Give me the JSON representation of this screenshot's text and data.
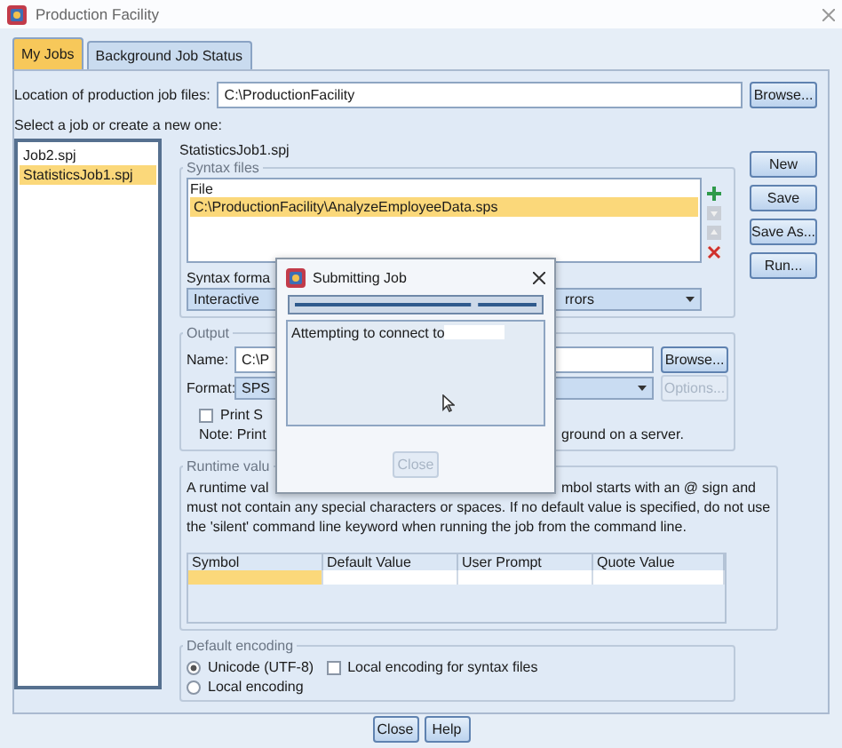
{
  "window": {
    "title": "Production Facility"
  },
  "tabs": [
    {
      "label": "My Jobs",
      "selected": true
    },
    {
      "label": "Background Job Status",
      "selected": false
    }
  ],
  "location": {
    "label": "Location of production job files:",
    "value": "C:\\ProductionFacility",
    "button": "Browse..."
  },
  "select_label": "Select a job or create a new one:",
  "jobs": [
    {
      "name": "Job2.spj",
      "selected": false
    },
    {
      "name": "StatisticsJob1.spj",
      "selected": true
    }
  ],
  "job_title": "StatisticsJob1.spj",
  "syntax_files": {
    "legend": "Syntax files",
    "header": "File",
    "rows": [
      {
        "path": "C:\\ProductionFacility\\AnalyzeEmployeeData.sps",
        "selected": true
      }
    ]
  },
  "syntax_format": {
    "label": "Syntax forma",
    "value_start": "Interactive",
    "value_end": "rrors"
  },
  "side_buttons": [
    {
      "label": "New"
    },
    {
      "label": "Save"
    },
    {
      "label": "Save As..."
    },
    {
      "label": "Run..."
    }
  ],
  "output": {
    "legend": "Output",
    "name_label": "Name:",
    "name_value": "C:\\P",
    "browse": "Browse...",
    "format_label": "Format:",
    "format_value": "SPS",
    "options": {
      "label": "Options...",
      "disabled": true
    },
    "print": {
      "label": "Print S",
      "checked": false
    },
    "note_start": "Note: Print",
    "note_end": "ground on a server."
  },
  "runtime": {
    "legend": "Runtime valu",
    "line1_start": "A runtime val",
    "line1_end": "mbol starts with an @ sign and",
    "line2": "must not contain any special characters or spaces. If no default value is specified, do not use",
    "line3": "the 'silent' command line keyword when running the job from the command line.",
    "columns": [
      "Symbol",
      "Default Value",
      "User Prompt",
      "Quote Value"
    ],
    "rows": [
      {
        "selected": true
      }
    ]
  },
  "encoding": {
    "legend": "Default encoding",
    "options": [
      {
        "label": "Unicode (UTF-8)",
        "selected": true
      },
      {
        "label": "Local encoding",
        "selected": false
      }
    ],
    "local_syntax": {
      "label": "Local encoding for syntax files",
      "checked": false
    }
  },
  "footer_buttons": [
    {
      "label": "Close"
    },
    {
      "label": "Help"
    }
  ],
  "modal": {
    "title": "Submitting Job",
    "level": 0.73,
    "message": "Attempting to connect to",
    "button": {
      "label": "Close",
      "disabled": true
    }
  }
}
